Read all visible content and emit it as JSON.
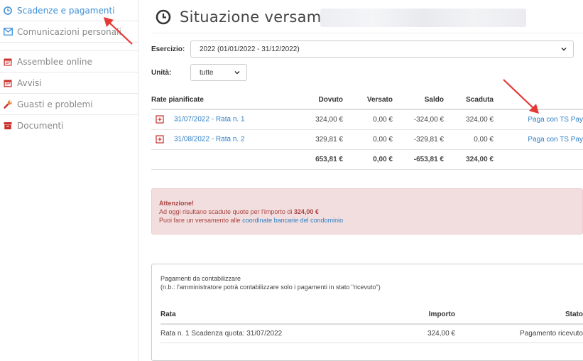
{
  "sidebar": {
    "items": [
      {
        "label": "Scadenze e pagamenti",
        "icon": "clock-icon"
      },
      {
        "label": "Comunicazioni personali",
        "icon": "envelope-icon"
      },
      {
        "label": "Assemblee online",
        "icon": "calendar-icon"
      },
      {
        "label": "Avvisi",
        "icon": "calendar-icon"
      },
      {
        "label": "Guasti e problemi",
        "icon": "wrench-icon"
      },
      {
        "label": "Documenti",
        "icon": "archive-icon"
      }
    ]
  },
  "page": {
    "title": "Situazione versamenti"
  },
  "filters": {
    "esercizio_label": "Esercizio:",
    "esercizio_value": "2022 (01/01/2022 - 31/12/2022)",
    "unita_label": "Unità:",
    "unita_value": "tutte"
  },
  "rates": {
    "headers": [
      "Rate pianificate",
      "Dovuto",
      "Versato",
      "Saldo",
      "Scaduta"
    ],
    "rows": [
      {
        "label": "31/07/2022 - Rata n. 1",
        "dovuto": "324,00 €",
        "versato": "0,00 €",
        "saldo": "-324,00 €",
        "scaduta": "324,00 €",
        "action": "Paga con TS Pay"
      },
      {
        "label": "31/08/2022 - Rata n. 2",
        "dovuto": "329,81 €",
        "versato": "0,00 €",
        "saldo": "-329,81 €",
        "scaduta": "0,00 €",
        "action": "Paga con TS Pay"
      }
    ],
    "totals": {
      "dovuto": "653,81 €",
      "versato": "0,00 €",
      "saldo": "-653,81 €",
      "scaduta": "324,00 €"
    }
  },
  "alert": {
    "title": "Attenzione!",
    "line1_prefix": "Ad oggi risultano scadute quote per l'importo di ",
    "line1_amount": "324,00 €",
    "line2_prefix": "Puoi fare un versamento alle ",
    "line2_link": "coordinate bancarie del condominio"
  },
  "pending": {
    "title": "Pagamenti da contabilizzare",
    "note": "(n.b.: l'amministratore potrà contabilizzare solo i pagamenti in stato \"ricevuto\")",
    "headers": [
      "Rata",
      "Importo",
      "Stato"
    ],
    "rows": [
      {
        "rata": "Rata n. 1 Scadenza quota: 31/07/2022",
        "importo": "324,00 €",
        "stato": "Pagamento ricevuto"
      }
    ]
  },
  "colors": {
    "accent": "#3b8fd6",
    "link": "#2f7fc5",
    "danger": "#c9302c",
    "arrow": "#e53935"
  }
}
